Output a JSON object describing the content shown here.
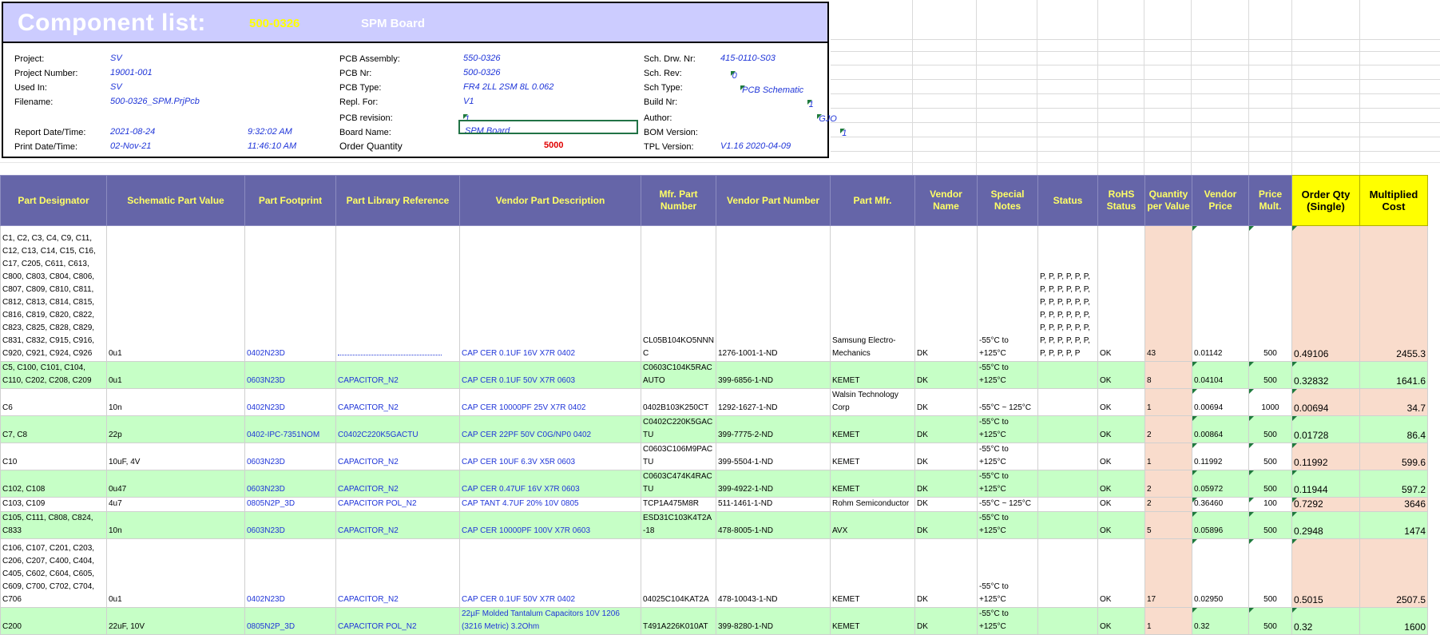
{
  "title": {
    "main": "Component list:",
    "code": "500-0326",
    "name": "SPM Board"
  },
  "info": {
    "project_label": "Project:",
    "project": "SV",
    "project_number_label": "Project Number:",
    "project_number": "19001-001",
    "used_in_label": "Used In:",
    "used_in": "SV",
    "filename_label": "Filename:",
    "filename": "500-0326_SPM.PrjPcb",
    "report_label": "Report Date/Time:",
    "report_date": "2021-08-24",
    "report_time": "9:32:02 AM",
    "print_label": "Print Date/Time:",
    "print_date": "02-Nov-21",
    "print_time": "11:46:10 AM",
    "pcb_assembly_label": "PCB Assembly:",
    "pcb_assembly": "550-0326",
    "pcb_nr_label": "PCB Nr:",
    "pcb_nr": "500-0326",
    "pcb_type_label": "PCB Type:",
    "pcb_type": "FR4 2LL 2SM 8L 0.062",
    "repl_label": "Repl. For:",
    "repl": "V1",
    "pcb_rev_label": "PCB revision:",
    "pcb_rev": "1",
    "board_name_label": "Board Name:",
    "board_name": "SPM Board",
    "order_qty_label": "Order Quantity",
    "order_qty": "5000",
    "sch_drw_label": "Sch. Drw. Nr:",
    "sch_drw": "415-0110-S03",
    "sch_rev_label": "Sch. Rev:",
    "sch_rev": "0",
    "sch_type_label": "Sch Type:",
    "sch_type": "PCB Schematic",
    "build_label": "Build Nr:",
    "build": "1",
    "author_label": "Author:",
    "author": "GJO",
    "bom_label": "BOM Version:",
    "bom": "1",
    "tpl_label": "TPL Version:",
    "tpl": "V1.16 2020-04-09"
  },
  "columns": [
    "Part Designator",
    "Schematic Part Value",
    "Part Footprint",
    "Part Library Reference",
    "Vendor Part Description",
    "Mfr. Part Number",
    "Vendor Part Number",
    "Part Mfr.",
    "Vendor Name",
    "Special Notes",
    "Status",
    "RoHS Status",
    "Quantity per Value",
    "Vendor Price",
    "Price Mult.",
    "Order Qty (Single)",
    "Multiplied Cost"
  ],
  "rows": [
    {
      "designator": "C1, C2, C3, C4, C9, C11, C12, C13, C14, C15, C16, C17, C205, C611, C613, C800, C803, C804, C806, C807, C809, C810, C811, C812, C813, C814, C815, C816, C819, C820, C822, C823, C825, C828, C829, C831, C832, C915, C916, C920, C921, C924, C926",
      "value": "0u1",
      "footprint": "0402N23D",
      "libref": "",
      "desc": "CAP CER 0.1UF 16V X7R 0402",
      "mfrpn": "CL05B104KO5NNNC",
      "vendorpn": "1276-1001-1-ND",
      "mfr": "Samsung Electro-Mechanics",
      "vendor": "DK",
      "notes": "-55°C to +125°C",
      "status": "P, P, P, P, P, P, P, P, P, P, P, P, P, P, P, P, P, P, P, P, P, P, P, P, P, P, P, P, P, P, P, P, P, P, P, P, P, P, P, P, P",
      "rohs": "OK",
      "qty": "43",
      "price": "0.01142",
      "mult": "500",
      "order": "0.49106",
      "cost": "2455.3"
    },
    {
      "designator": "C5, C100, C101, C104, C110, C202, C208, C209",
      "value": "0u1",
      "footprint": "0603N23D",
      "libref": "CAPACITOR_N2",
      "desc": "CAP CER 0.1UF 50V X7R 0603",
      "mfrpn": "C0603C104K5RACAUTO",
      "vendorpn": "399-6856-1-ND",
      "mfr": "KEMET",
      "vendor": "DK",
      "notes": "-55°C to +125°C",
      "status": "",
      "rohs": "OK",
      "qty": "8",
      "price": "0.04104",
      "mult": "500",
      "order": "0.32832",
      "cost": "1641.6"
    },
    {
      "designator": "C6",
      "value": "10n",
      "footprint": "0402N23D",
      "libref": "CAPACITOR_N2",
      "desc": "CAP CER 10000PF 25V X7R 0402",
      "mfrpn": "0402B103K250CT",
      "vendorpn": "1292-1627-1-ND",
      "mfr": "Walsin Technology Corp",
      "vendor": "DK",
      "notes": "-55°C ~ 125°C",
      "status": "",
      "rohs": "OK",
      "qty": "1",
      "price": "0.00694",
      "mult": "1000",
      "order": "0.00694",
      "cost": "34.7"
    },
    {
      "designator": "C7, C8",
      "value": "22p",
      "footprint": "0402-IPC-7351NOM",
      "libref": "C0402C220K5GACTU",
      "desc": "CAP CER 22PF 50V C0G/NP0 0402",
      "mfrpn": "C0402C220K5GACTU",
      "vendorpn": "399-7775-2-ND",
      "mfr": "KEMET",
      "vendor": "DK",
      "notes": "-55°C to +125°C",
      "status": "",
      "rohs": "OK",
      "qty": "2",
      "price": "0.00864",
      "mult": "500",
      "order": "0.01728",
      "cost": "86.4"
    },
    {
      "designator": "C10",
      "value": "10uF, 4V",
      "footprint": "0603N23D",
      "libref": "CAPACITOR_N2",
      "desc": "CAP CER 10UF 6.3V X5R 0603",
      "mfrpn": "C0603C106M9PACTU",
      "vendorpn": "399-5504-1-ND",
      "mfr": "KEMET",
      "vendor": "DK",
      "notes": "-55°C to +125°C",
      "status": "",
      "rohs": "OK",
      "qty": "1",
      "price": "0.11992",
      "mult": "500",
      "order": "0.11992",
      "cost": "599.6"
    },
    {
      "designator": "C102, C108",
      "value": "0u47",
      "footprint": "0603N23D",
      "libref": "CAPACITOR_N2",
      "desc": "CAP CER 0.47UF 16V X7R 0603",
      "mfrpn": "C0603C474K4RACTU",
      "vendorpn": "399-4922-1-ND",
      "mfr": "KEMET",
      "vendor": "DK",
      "notes": "-55°C to +125°C",
      "status": "",
      "rohs": "OK",
      "qty": "2",
      "price": "0.05972",
      "mult": "500",
      "order": "0.11944",
      "cost": "597.2"
    },
    {
      "designator": "C103, C109",
      "value": "4u7",
      "footprint": "0805N2P_3D",
      "libref": "CAPACITOR POL_N2",
      "desc": "CAP TANT 4.7UF 20% 10V 0805",
      "mfrpn": "TCP1A475M8R",
      "vendorpn": "511-1461-1-ND",
      "mfr": "Rohm Semiconductor",
      "vendor": "DK",
      "notes": "-55°C ~ 125°C",
      "status": "",
      "rohs": "OK",
      "qty": "2",
      "price": "0.36460",
      "mult": "100",
      "order": "0.7292",
      "cost": "3646"
    },
    {
      "designator": "C105, C111, C808, C824, C833",
      "value": "10n",
      "footprint": "0603N23D",
      "libref": "CAPACITOR_N2",
      "desc": "CAP CER 10000PF 100V X7R 0603",
      "mfrpn": "ESD31C103K4T2A-18",
      "vendorpn": "478-8005-1-ND",
      "mfr": "AVX",
      "vendor": "DK",
      "notes": "-55°C to +125°C",
      "status": "",
      "rohs": "OK",
      "qty": "5",
      "price": "0.05896",
      "mult": "500",
      "order": "0.2948",
      "cost": "1474"
    },
    {
      "designator": "C106, C107, C201, C203, C206, C207, C400, C404, C405, C602, C604, C605, C609, C700, C702, C704, C706",
      "value": "0u1",
      "footprint": "0402N23D",
      "libref": "CAPACITOR_N2",
      "desc": "CAP CER 0.1UF 50V X7R 0402",
      "mfrpn": "04025C104KAT2A",
      "vendorpn": "478-10043-1-ND",
      "mfr": "KEMET",
      "vendor": "DK",
      "notes": "-55°C to +125°C",
      "status": "",
      "rohs": "OK",
      "qty": "17",
      "price": "0.02950",
      "mult": "500",
      "order": "0.5015",
      "cost": "2507.5"
    },
    {
      "designator": "C200",
      "value": "22uF, 10V",
      "footprint": "0805N2P_3D",
      "libref": "CAPACITOR POL_N2",
      "desc": "22µF Molded Tantalum Capacitors 10V 1206 (3216 Metric) 3.2Ohm",
      "mfrpn": "T491A226K010AT",
      "vendorpn": "399-8280-1-ND",
      "mfr": "KEMET",
      "vendor": "DK",
      "notes": "-55°C to +125°C",
      "status": "",
      "rohs": "OK",
      "qty": "1",
      "price": "0.32",
      "mult": "500",
      "order": "0.32",
      "cost": "1600"
    }
  ]
}
